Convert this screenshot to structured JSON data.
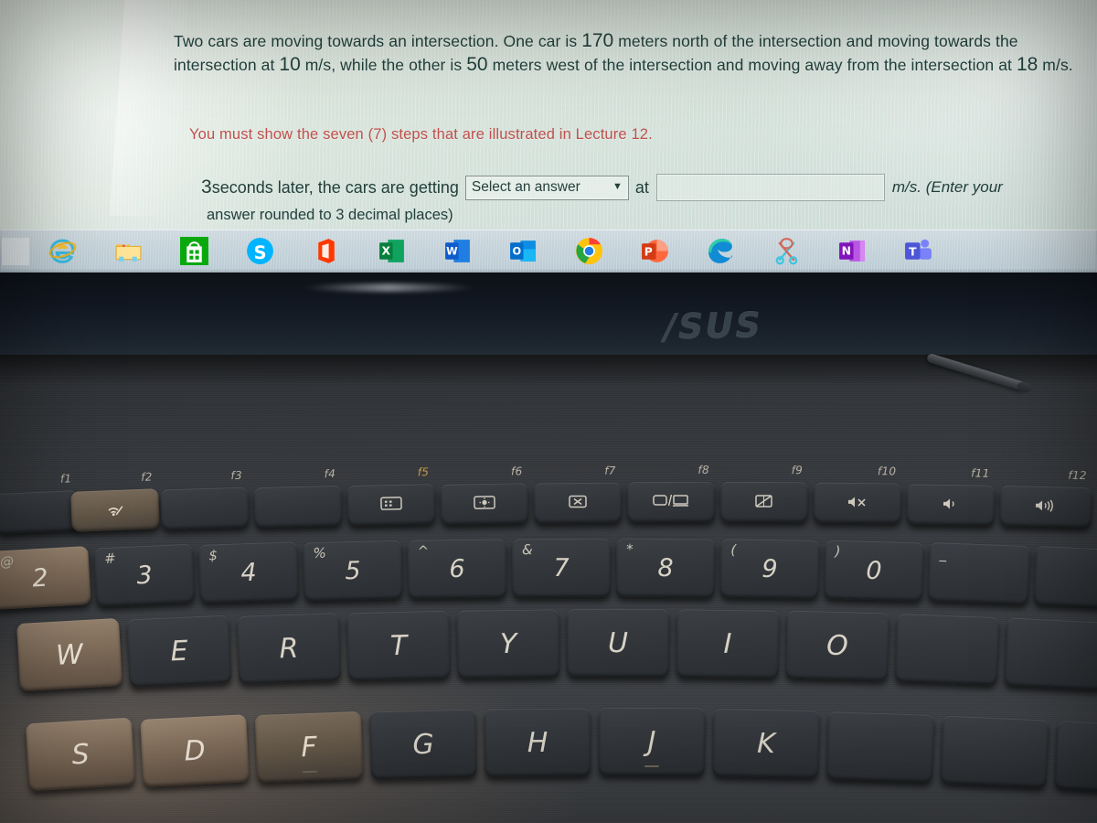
{
  "screen": {
    "problem": {
      "line1_a": "Two cars are moving towards an intersection. One car is ",
      "value_distance_north": "170",
      "line1_b": " meters north of the intersection and moving towards the intersection at ",
      "value_speed_north": "10",
      "line1_c": " m/s, while the other is ",
      "value_distance_west": "50",
      "line1_d": " meters west of the intersection and moving away from the intersection at ",
      "value_speed_west": "18",
      "line1_e": " m/s."
    },
    "instruction_warning": "You must show the seven (7) steps that are illustrated in Lecture 12.",
    "question": {
      "time_value": "3",
      "lead": " seconds later, the cars are getting ",
      "dropdown_value": "Select an answer",
      "dropdown_chevron": "⌄",
      "mid": "at",
      "answer_input_value": "",
      "unit": "m/s.",
      "hint_line1": "(Enter your",
      "hint_line2": "answer rounded to 3 decimal places)"
    },
    "colors": {
      "body_text": "#21413c",
      "warning_text": "#c0504d",
      "screen_bg": "#d8e4dc"
    }
  },
  "taskbar": {
    "items": [
      {
        "name": "start-button",
        "label": ""
      },
      {
        "name": "internet-explorer-icon",
        "label": "Internet Explorer"
      },
      {
        "name": "file-explorer-icon",
        "label": "File Explorer"
      },
      {
        "name": "microsoft-store-icon",
        "label": "Microsoft Store"
      },
      {
        "name": "skype-icon",
        "label": "Skype"
      },
      {
        "name": "office-icon",
        "label": "Office"
      },
      {
        "name": "excel-icon",
        "label": "Excel"
      },
      {
        "name": "word-icon",
        "label": "Word"
      },
      {
        "name": "outlook-icon",
        "label": "Outlook"
      },
      {
        "name": "chrome-icon",
        "label": "Google Chrome"
      },
      {
        "name": "powerpoint-icon",
        "label": "PowerPoint"
      },
      {
        "name": "edge-icon",
        "label": "Microsoft Edge"
      },
      {
        "name": "snipping-tool-icon",
        "label": "Snipping Tool"
      },
      {
        "name": "onenote-icon",
        "label": "OneNote"
      },
      {
        "name": "teams-icon",
        "label": "Microsoft Teams"
      }
    ]
  },
  "laptop": {
    "brand": "/SUS",
    "keyboard": {
      "function_row": [
        {
          "label": "f1",
          "glyph": ""
        },
        {
          "label": "f2",
          "glyph": "airplane-wifi"
        },
        {
          "label": "f3",
          "glyph": ""
        },
        {
          "label": "f4",
          "glyph": ""
        },
        {
          "label": "f5",
          "glyph": "keyboard-backlight-down",
          "amber": true
        },
        {
          "label": "f6",
          "glyph": "keyboard-backlight-up"
        },
        {
          "label": "f7",
          "glyph": "display-off"
        },
        {
          "label": "f8",
          "glyph": "display-switch"
        },
        {
          "label": "f9",
          "glyph": "touchpad-toggle"
        },
        {
          "label": "f10",
          "glyph": "mute"
        },
        {
          "label": "f11",
          "glyph": "volume-down"
        },
        {
          "label": "f12",
          "glyph": "volume-up"
        }
      ],
      "number_row": [
        {
          "main": "2",
          "shift": "@"
        },
        {
          "main": "3",
          "shift": "#"
        },
        {
          "main": "4",
          "shift": "$"
        },
        {
          "main": "5",
          "shift": "%"
        },
        {
          "main": "6",
          "shift": "^"
        },
        {
          "main": "7",
          "shift": "&"
        },
        {
          "main": "8",
          "shift": "*"
        },
        {
          "main": "9",
          "shift": "("
        },
        {
          "main": "0",
          "shift": ")"
        },
        {
          "main": "",
          "shift": "_"
        }
      ],
      "letter_row_top": [
        "W",
        "E",
        "R",
        "T",
        "Y",
        "U",
        "I",
        "O"
      ],
      "letter_row_home": [
        "S",
        "D",
        "F",
        "G",
        "H",
        "J",
        "K"
      ]
    }
  }
}
